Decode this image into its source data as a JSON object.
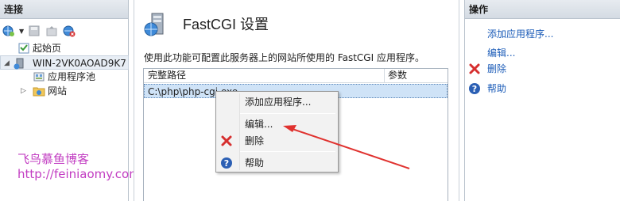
{
  "left_panel": {
    "title": "连接",
    "tree": {
      "start_page": "起始页",
      "server": "WIN-2VK0AOAD9K7",
      "app_pools": "应用程序池",
      "sites": "网站"
    }
  },
  "main": {
    "title": "FastCGI 设置",
    "description": "使用此功能可配置此服务器上的网站所使用的 FastCGI 应用程序。",
    "table": {
      "columns": [
        "完整路径",
        "参数"
      ],
      "rows": [
        {
          "path": "C:\\php\\php-cgi.exe",
          "args": ""
        }
      ]
    }
  },
  "context_menu": {
    "items": [
      "添加应用程序...",
      "编辑...",
      "删除",
      "帮助"
    ]
  },
  "right_panel": {
    "title": "操作",
    "actions": [
      "添加应用程序...",
      "编辑...",
      "删除",
      "帮助"
    ]
  },
  "watermark": {
    "name": "飞鸟慕鱼博客",
    "url": "http://feiniaomy.com"
  },
  "colors": {
    "link": "#1c5cb8",
    "delete_red": "#d62f2f",
    "help_blue": "#2b5fb4",
    "selection": "#cfe3f7",
    "watermark": "#c23dc2",
    "arrow": "#e0322f"
  }
}
